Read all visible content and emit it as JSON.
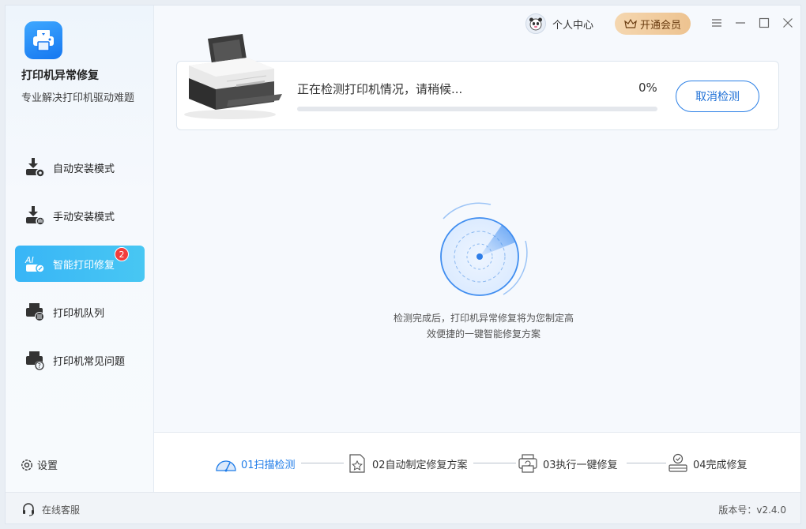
{
  "app": {
    "name": "打印机异常修复",
    "subtitle": "专业解决打印机驱动难题"
  },
  "nav": {
    "items": [
      {
        "label": "自动安装模式",
        "icon": "download-gear-icon"
      },
      {
        "label": "手动安装模式",
        "icon": "download-hand-icon"
      },
      {
        "label": "智能打印修复",
        "icon": "ai-printer-repair-icon",
        "badge": "2",
        "active": true
      },
      {
        "label": "打印机队列",
        "icon": "printer-queue-icon"
      },
      {
        "label": "打印机常见问题",
        "icon": "printer-question-icon"
      }
    ]
  },
  "sidebar": {
    "settings_label": "设置"
  },
  "header": {
    "user_center": "个人中心",
    "vip_button": "开通会员"
  },
  "detection": {
    "status_text": "正在检测打印机情况，请稍候...",
    "percent_label": "0%",
    "progress": 0,
    "cancel_button": "取消检测"
  },
  "hint": {
    "line1": "检测完成后，打印机异常修复将为您制定高",
    "line2": "效便捷的一键智能修复方案"
  },
  "steps": [
    {
      "label": "01扫描检测",
      "icon": "scan-gauge-icon",
      "active": true
    },
    {
      "label": "02自动制定修复方案",
      "icon": "document-star-icon",
      "active": false
    },
    {
      "label": "03执行一键修复",
      "icon": "printer-refresh-icon",
      "active": false
    },
    {
      "label": "04完成修复",
      "icon": "check-device-icon",
      "active": false
    }
  ],
  "footer": {
    "service": "在线客服",
    "version": "版本号：v2.4.0"
  },
  "colors": {
    "accent": "#1f7ce8",
    "active_nav": "#3bb8f5",
    "badge": "#f23c3c",
    "vip": "#efc898"
  }
}
